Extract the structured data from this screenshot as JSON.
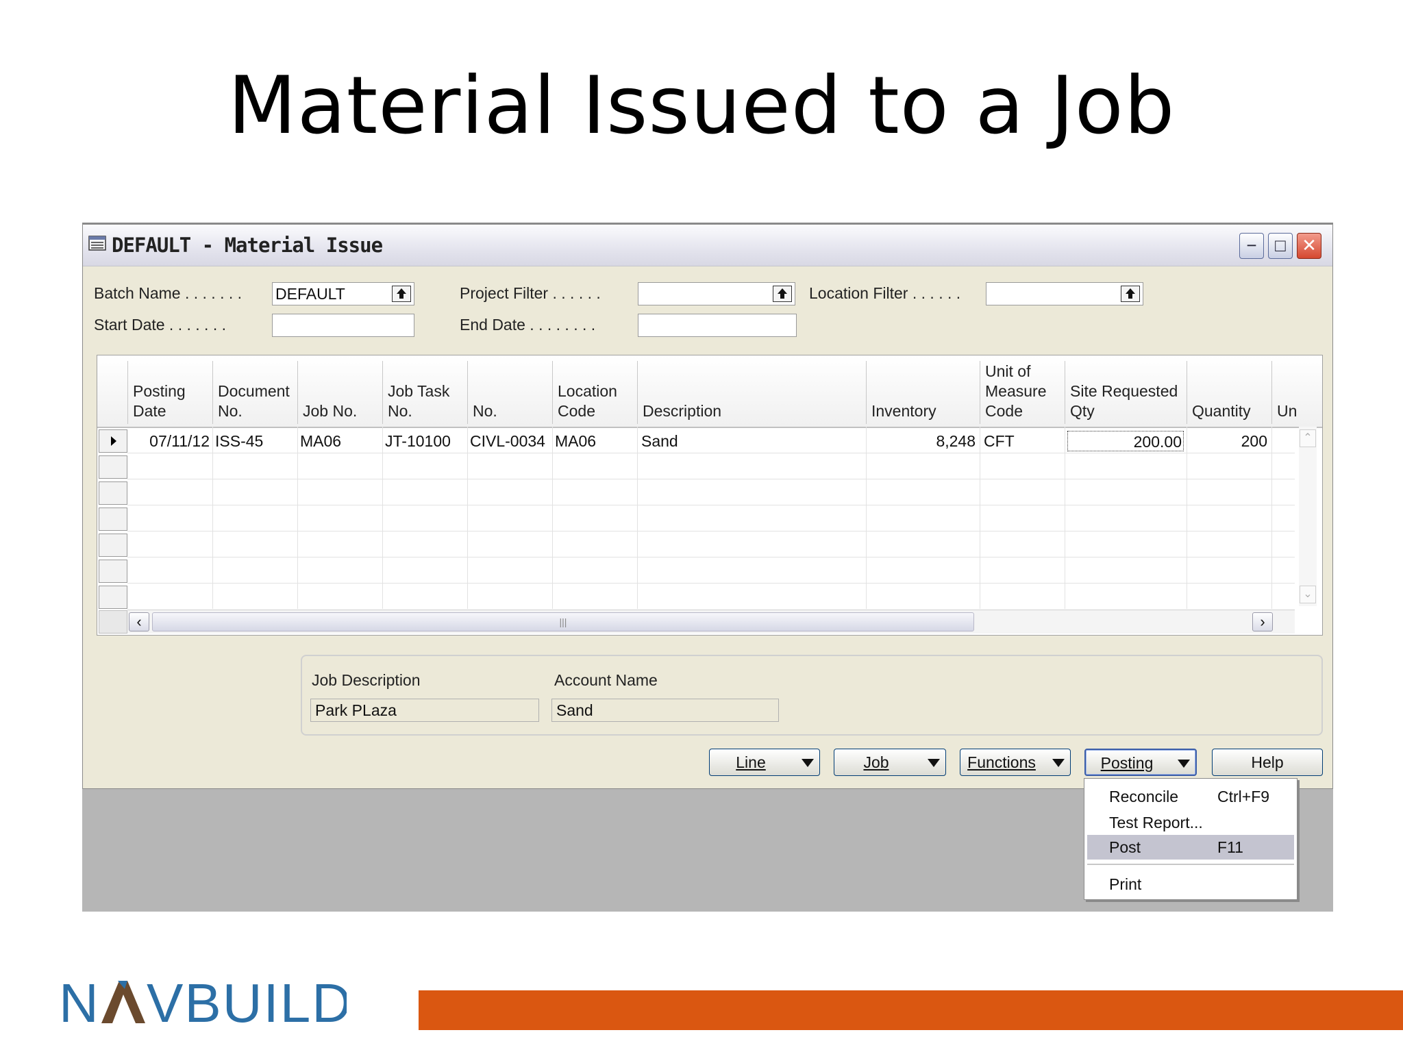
{
  "slide": {
    "title": "Material Issued to a Job"
  },
  "window": {
    "title": "DEFAULT - Material Issue"
  },
  "filters": {
    "batch_name_label": "Batch Name . . . . . . .",
    "batch_name_value": "DEFAULT",
    "start_date_label": "Start Date . . . . . . .",
    "start_date_value": "",
    "project_filter_label": "Project Filter . . . . . .",
    "project_filter_value": "",
    "end_date_label": "End Date . . . . . . . .",
    "end_date_value": "",
    "location_filter_label": "Location Filter . . . . . .",
    "location_filter_value": ""
  },
  "grid": {
    "columns": [
      {
        "l1": "Posting",
        "l2": "Date"
      },
      {
        "l1": "Document",
        "l2": "No."
      },
      {
        "l1": "",
        "l2": "Job No."
      },
      {
        "l1": "Job Task",
        "l2": "No."
      },
      {
        "l1": "",
        "l2": "No."
      },
      {
        "l1": "Location",
        "l2": "Code"
      },
      {
        "l1": "",
        "l2": "Description"
      },
      {
        "l1": "",
        "l2": "Inventory"
      },
      {
        "l0": "Unit of",
        "l1": "Measure",
        "l2": "Code"
      },
      {
        "l1": "Site Requested",
        "l2": "Qty"
      },
      {
        "l1": "",
        "l2": "Quantity"
      },
      {
        "l1": "",
        "l2": "Un"
      }
    ],
    "rows": [
      {
        "posting_date": "07/11/12",
        "document_no": "ISS-45",
        "job_no": "MA06",
        "job_task_no": "JT-10100",
        "no": "CIVL-0034",
        "location_code": "MA06",
        "description": "Sand",
        "inventory": "8,248",
        "uom_code": "CFT",
        "site_requested_qty": "200.00",
        "quantity": "200"
      }
    ]
  },
  "info": {
    "job_description_label": "Job Description",
    "job_description_value": "Park PLaza",
    "account_name_label": "Account Name",
    "account_name_value": "Sand"
  },
  "buttons": {
    "line": "Line",
    "job": "Job",
    "functions": "Functions",
    "posting": "Posting",
    "help": "Help"
  },
  "posting_menu": {
    "items": [
      {
        "label": "Reconcile",
        "shortcut": "Ctrl+F9"
      },
      {
        "label": "Test Report...",
        "shortcut": ""
      },
      {
        "label": "Post",
        "shortcut": "F11"
      },
      {
        "label": "Print",
        "shortcut": ""
      }
    ],
    "highlighted_index": 2
  },
  "footer": {
    "logo_text": "NAVBUILD"
  },
  "colors": {
    "accent_orange": "#da5711",
    "logo_blue": "#2c6fa6",
    "logo_brown": "#6b4a2e"
  }
}
